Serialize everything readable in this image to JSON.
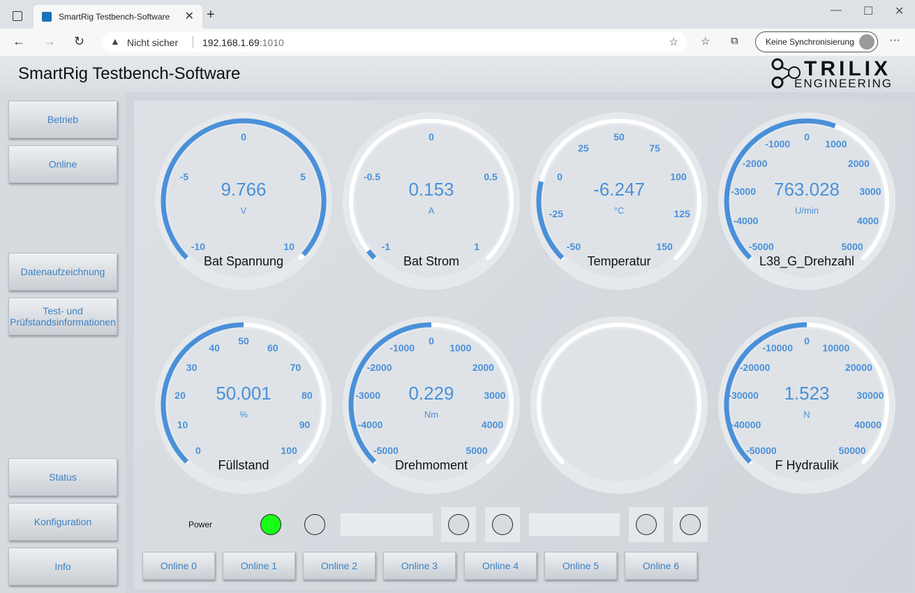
{
  "browser": {
    "tab_title": "SmartRig Testbench-Software",
    "security_label": "Nicht sicher",
    "url_host": "192.168.1.69",
    "url_port": ":1010",
    "sync_label": "Keine Synchronisierung"
  },
  "app": {
    "title": "SmartRig Testbench-Software",
    "logo_top": "TRILIX",
    "logo_bottom": "ENGINEERING"
  },
  "sidebar": {
    "betrieb": "Betrieb",
    "online": "Online",
    "datenaufzeichnung": "Datenaufzeichnung",
    "test_info": "Test- und Prüfstandsinformationen",
    "status": "Status",
    "konfiguration": "Konfiguration",
    "info": "Info"
  },
  "gauges": [
    {
      "name": "Bat Spannung",
      "value": "9.766",
      "unit": "V",
      "min": -10,
      "max": 10,
      "reading": 9.766,
      "ticks": [
        "-10",
        "-5",
        "0",
        "5",
        "10"
      ]
    },
    {
      "name": "Bat Strom",
      "value": "0.153",
      "unit": "A",
      "min": -1,
      "max": 1,
      "reading": -0.95,
      "ticks": [
        "-1",
        "-0.5",
        "0",
        "0.5",
        "1"
      ]
    },
    {
      "name": "Temperatur",
      "value": "-6.247",
      "unit": "°C",
      "min": -50,
      "max": 150,
      "reading": -6.247,
      "ticks": [
        "-50",
        "-25",
        "0",
        "25",
        "50",
        "75",
        "100",
        "125",
        "150"
      ]
    },
    {
      "name": "L38_G_Drehzahl",
      "value": "763.028",
      "unit": "U/min",
      "min": -5000,
      "max": 5000,
      "reading": 763.028,
      "ticks": [
        "-5000",
        "-4000",
        "-3000",
        "-2000",
        "-1000",
        "0",
        "1000",
        "2000",
        "3000",
        "4000",
        "5000"
      ]
    },
    {
      "name": "Füllstand",
      "value": "50.001",
      "unit": "%",
      "min": 0,
      "max": 100,
      "reading": 50.001,
      "ticks": [
        "0",
        "10",
        "20",
        "30",
        "40",
        "50",
        "60",
        "70",
        "80",
        "90",
        "100"
      ]
    },
    {
      "name": "Drehmoment",
      "value": "0.229",
      "unit": "Nm",
      "min": -5000,
      "max": 5000,
      "reading": 0.229,
      "ticks": [
        "-5000",
        "-4000",
        "-3000",
        "-2000",
        "-1000",
        "0",
        "1000",
        "2000",
        "3000",
        "4000",
        "5000"
      ]
    },
    {
      "name": "",
      "value": "",
      "unit": "",
      "min": 0,
      "max": 1,
      "reading": null,
      "ticks": []
    },
    {
      "name": "F Hydraulik",
      "value": "1.523",
      "unit": "N",
      "min": -50000,
      "max": 50000,
      "reading": 1.523,
      "ticks": [
        "-50000",
        "-40000",
        "-30000",
        "-20000",
        "-10000",
        "0",
        "10000",
        "20000",
        "30000",
        "40000",
        "50000"
      ]
    }
  ],
  "indicators": {
    "power_label": "Power",
    "on_color": "#19ff19",
    "off_color": "#d8dce0",
    "accent": "#4a90d9"
  },
  "online_buttons": [
    "Online 0",
    "Online 1",
    "Online 2",
    "Online 3",
    "Online 4",
    "Online 5",
    "Online 6"
  ]
}
